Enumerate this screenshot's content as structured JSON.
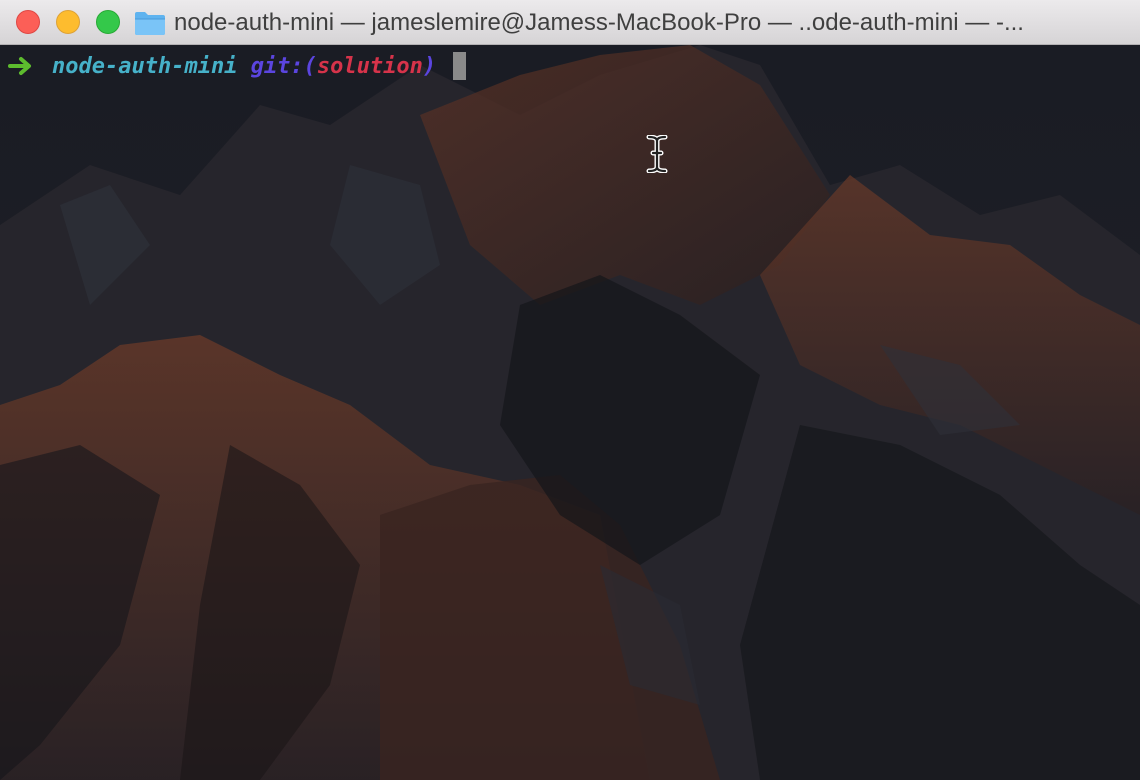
{
  "window": {
    "title": "node-auth-mini — jameslemire@Jamess-MacBook-Pro — ..ode-auth-mini — -...",
    "folder_icon": "folder-icon"
  },
  "colors": {
    "close": "#fc5f57",
    "minimize": "#fdbc2e",
    "maximize": "#34c84a",
    "prompt_arrow": "#5dbb2e",
    "directory": "#46b1c9",
    "git_label": "#5b45e0",
    "branch": "#d6334a",
    "background": "#1b1d24"
  },
  "prompt": {
    "arrow_icon": "right-arrow-icon",
    "directory": "node-auth-mini",
    "git_label": "git:",
    "open_paren": "(",
    "branch": "solution",
    "close_paren": ")"
  }
}
